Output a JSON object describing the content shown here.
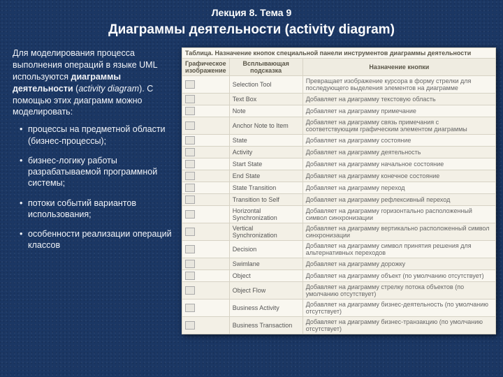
{
  "header": {
    "lecture": "Лекция 8. Тема 9",
    "title": "Диаграммы деятельности (activity diagram)"
  },
  "intro": {
    "p1a": "Для моделирования процесса выполнения операций в языке UML используются ",
    "p1b": "диаграммы деятельности",
    "p1c": " (",
    "p1d": "activity diagram",
    "p1e": "). С помощью этих диаграмм можно моделировать:"
  },
  "bullets": [
    "процессы на предметной области (бизнес-процессы);",
    "бизнес-логику работы разрабатываемой программной системы;",
    "потоки событий вариантов использования;",
    "особенности реализации операций классов"
  ],
  "table": {
    "caption": "Таблица. Назначение кнопок специальной панели инструментов диаграммы деятельности",
    "headers": [
      "Графическое изображение",
      "Всплывающая подсказка",
      "Назначение кнопки"
    ],
    "rows": [
      {
        "hint": "Selection Tool",
        "desc": "Превращает изображение курсора в форму стрелки для последующего выделения элементов на диаграмме"
      },
      {
        "hint": "Text Box",
        "desc": "Добавляет на диаграмму текстовую область"
      },
      {
        "hint": "Note",
        "desc": "Добавляет на диаграмму примечание"
      },
      {
        "hint": "Anchor Note to Item",
        "desc": "Добавляет на диаграмму связь примечания с соответствующим графическим элементом диаграммы"
      },
      {
        "hint": "State",
        "desc": "Добавляет на диаграмму состояние"
      },
      {
        "hint": "Activity",
        "desc": "Добавляет на диаграмму деятельность"
      },
      {
        "hint": "Start State",
        "desc": "Добавляет на диаграмму начальное состояние"
      },
      {
        "hint": "End State",
        "desc": "Добавляет на диаграмму конечное состояние"
      },
      {
        "hint": "State Transition",
        "desc": "Добавляет на диаграмму переход"
      },
      {
        "hint": "Transition to Self",
        "desc": "Добавляет на диаграмму рефлексивный переход"
      },
      {
        "hint": "Horizontal Synchronization",
        "desc": "Добавляет на диаграмму горизонтально расположенный символ синхронизации"
      },
      {
        "hint": "Vertical Synchronization",
        "desc": "Добавляет на диаграмму вертикально расположенный символ синхронизации"
      },
      {
        "hint": "Decision",
        "desc": "Добавляет на диаграмму символ принятия решения для альтернативных переходов"
      },
      {
        "hint": "Swimlane",
        "desc": "Добавляет на диаграмму дорожку"
      },
      {
        "hint": "Object",
        "desc": "Добавляет на диаграмму объект (по умолчанию отсутствует)"
      },
      {
        "hint": "Object Flow",
        "desc": "Добавляет на диаграмму стрелку потока объектов (по умолчанию отсутствует)"
      },
      {
        "hint": "Business Activity",
        "desc": "Добавляет на диаграмму бизнес-деятельность (по умолчанию отсутствует)"
      },
      {
        "hint": "Business Transaction",
        "desc": "Добавляет на диаграмму бизнес-транзакцию (по умолчанию отсутствует)"
      }
    ]
  }
}
